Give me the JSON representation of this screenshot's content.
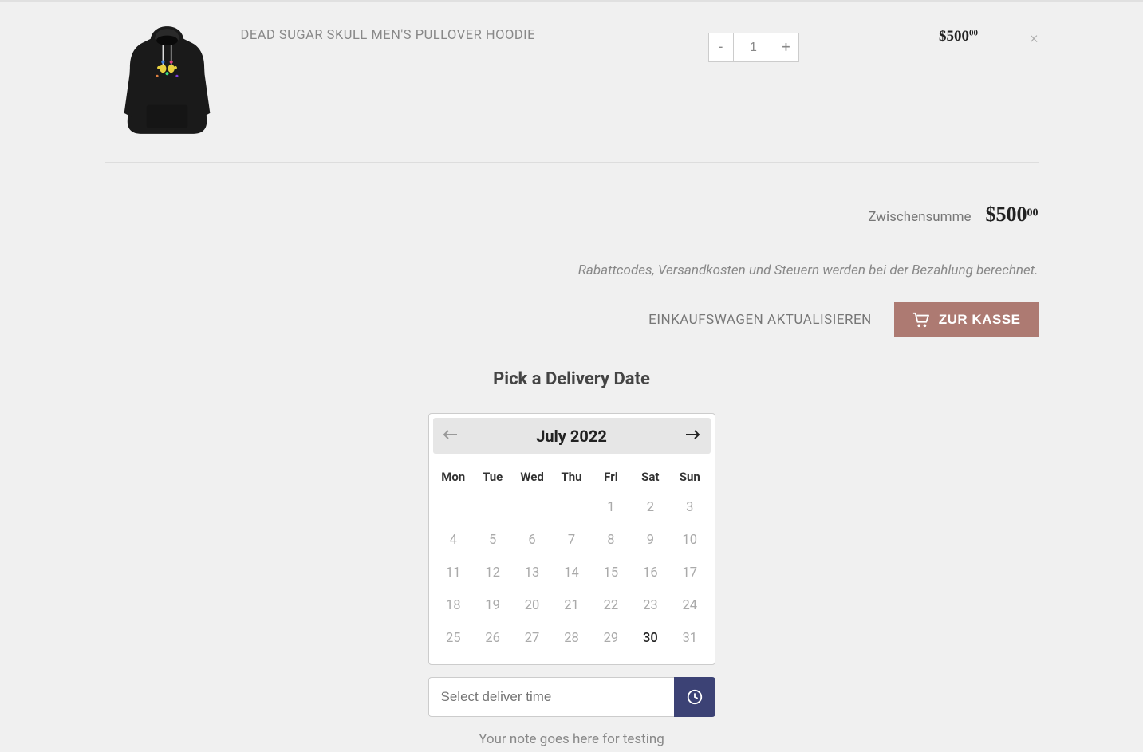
{
  "cart": {
    "product_title": "DEAD SUGAR SKULL MEN'S PULLOVER HOODIE",
    "quantity": "1",
    "price": "$500",
    "price_cents": "00"
  },
  "subtotal": {
    "label": "Zwischensumme",
    "price": "$500",
    "price_cents": "00"
  },
  "tax_note": "Rabattcodes, Versandkosten und Steuern werden bei der Bezahlung berechnet.",
  "actions": {
    "update_cart": "EINKAUFSWAGEN AKTUALISIEREN",
    "checkout": "ZUR KASSE"
  },
  "delivery": {
    "title": "Pick a Delivery Date",
    "month": "July 2022",
    "day_headers": [
      "Mon",
      "Tue",
      "Wed",
      "Thu",
      "Fri",
      "Sat",
      "Sun"
    ],
    "weeks": [
      [
        {
          "d": "",
          "t": "empty"
        },
        {
          "d": "",
          "t": "empty"
        },
        {
          "d": "",
          "t": "empty"
        },
        {
          "d": "",
          "t": "empty"
        },
        {
          "d": "1",
          "t": "disabled"
        },
        {
          "d": "2",
          "t": "disabled"
        },
        {
          "d": "3",
          "t": "disabled"
        }
      ],
      [
        {
          "d": "4",
          "t": "disabled"
        },
        {
          "d": "5",
          "t": "disabled"
        },
        {
          "d": "6",
          "t": "disabled"
        },
        {
          "d": "7",
          "t": "disabled"
        },
        {
          "d": "8",
          "t": "disabled"
        },
        {
          "d": "9",
          "t": "disabled"
        },
        {
          "d": "10",
          "t": "disabled"
        }
      ],
      [
        {
          "d": "11",
          "t": "disabled"
        },
        {
          "d": "12",
          "t": "disabled"
        },
        {
          "d": "13",
          "t": "disabled"
        },
        {
          "d": "14",
          "t": "disabled"
        },
        {
          "d": "15",
          "t": "disabled"
        },
        {
          "d": "16",
          "t": "disabled"
        },
        {
          "d": "17",
          "t": "disabled"
        }
      ],
      [
        {
          "d": "18",
          "t": "disabled"
        },
        {
          "d": "19",
          "t": "disabled"
        },
        {
          "d": "20",
          "t": "disabled"
        },
        {
          "d": "21",
          "t": "disabled"
        },
        {
          "d": "22",
          "t": "disabled"
        },
        {
          "d": "23",
          "t": "disabled"
        },
        {
          "d": "24",
          "t": "disabled"
        }
      ],
      [
        {
          "d": "25",
          "t": "disabled"
        },
        {
          "d": "26",
          "t": "disabled"
        },
        {
          "d": "27",
          "t": "disabled"
        },
        {
          "d": "28",
          "t": "disabled"
        },
        {
          "d": "29",
          "t": "disabled"
        },
        {
          "d": "30",
          "t": "active"
        },
        {
          "d": "31",
          "t": "disabled"
        }
      ]
    ],
    "time_placeholder": "Select deliver time",
    "note": "Your note goes here for testing"
  }
}
